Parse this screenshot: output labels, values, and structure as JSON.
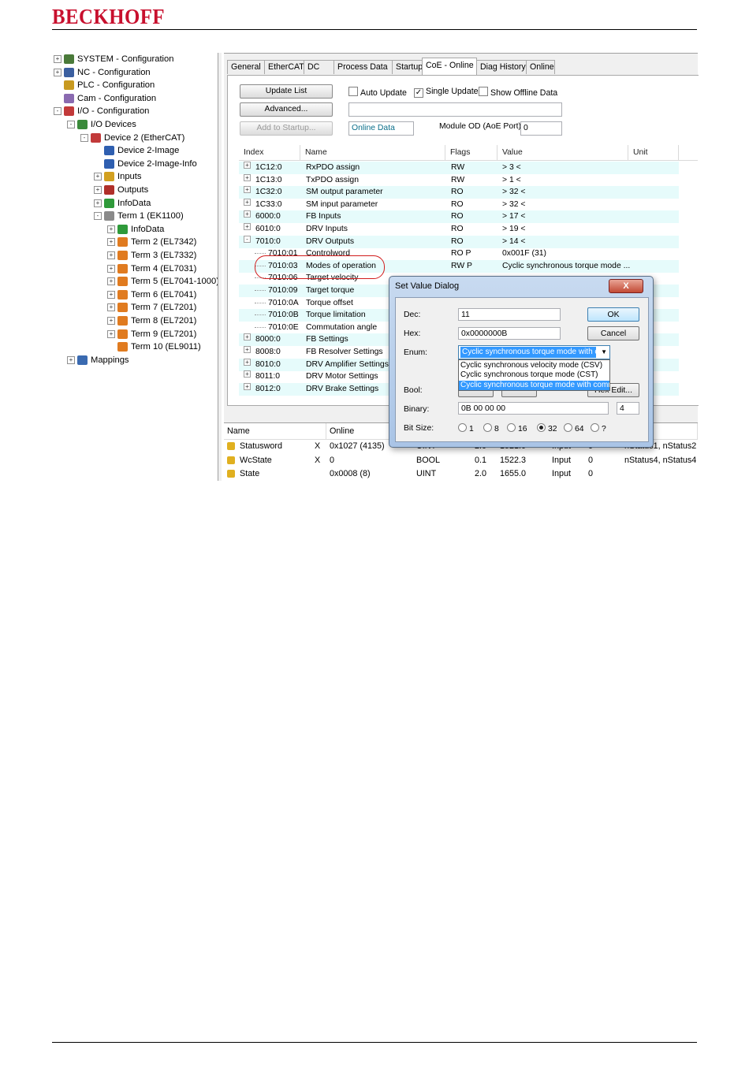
{
  "page": {
    "brand": "BECKHOFF",
    "brand_color": "#c8102e"
  },
  "tree": {
    "items": [
      {
        "label": "SYSTEM - Configuration",
        "icon": "system-config-icon"
      },
      {
        "label": "NC - Configuration",
        "icon": "nc-config-icon"
      },
      {
        "label": "PLC - Configuration",
        "icon": "plc-config-icon"
      },
      {
        "label": "Cam - Configuration",
        "icon": "cam-config-icon"
      },
      {
        "label": "I/O - Configuration",
        "icon": "io-config-icon"
      },
      {
        "label": "I/O Devices",
        "icon": "io-devices-icon"
      },
      {
        "label": "Device 2 (EtherCAT)",
        "icon": "ethercat-device-icon"
      },
      {
        "label": "Device 2-Image",
        "icon": "image-icon"
      },
      {
        "label": "Device 2-Image-Info",
        "icon": "image-info-icon"
      },
      {
        "label": "Inputs",
        "icon": "inputs-icon"
      },
      {
        "label": "Outputs",
        "icon": "outputs-icon"
      },
      {
        "label": "InfoData",
        "icon": "infodata-icon"
      },
      {
        "label": "Term 1 (EK1100)",
        "icon": "coupler-icon"
      },
      {
        "label": "InfoData",
        "icon": "infodata-icon"
      },
      {
        "label": "Term 2 (EL7342)",
        "icon": "terminal-icon"
      },
      {
        "label": "Term 3 (EL7332)",
        "icon": "terminal-icon"
      },
      {
        "label": "Term 4 (EL7031)",
        "icon": "terminal-icon"
      },
      {
        "label": "Term 5 (EL7041-1000)",
        "icon": "terminal-icon"
      },
      {
        "label": "Term 6 (EL7041)",
        "icon": "terminal-icon"
      },
      {
        "label": "Term 7 (EL7201)",
        "icon": "terminal-icon"
      },
      {
        "label": "Term 8 (EL7201)",
        "icon": "terminal-icon"
      },
      {
        "label": "Term 9 (EL7201)",
        "icon": "terminal-icon"
      },
      {
        "label": "Term 10 (EL9011)",
        "icon": "end-terminal-icon"
      },
      {
        "label": "Mappings",
        "icon": "mappings-icon"
      }
    ]
  },
  "tabs": [
    "General",
    "EtherCAT",
    "DC",
    "Process Data",
    "Startup",
    "CoE - Online",
    "Diag History",
    "Online"
  ],
  "coe": {
    "update_list": "Update List",
    "advanced": "Advanced...",
    "add_to_startup": "Add to Startup...",
    "auto_update": "Auto Update",
    "single_update": "Single Update",
    "show_offline": "Show Offline Data",
    "online_data": "Online Data",
    "module_od_label": "Module OD (AoE Port):",
    "module_od_value": "0",
    "headers": [
      "Index",
      "Name",
      "Flags",
      "Value",
      "Unit"
    ],
    "rows": [
      {
        "exp": "+",
        "index": "1C12:0",
        "name": "RxPDO assign",
        "flags": "RW",
        "value": "> 3 <"
      },
      {
        "exp": "+",
        "index": "1C13:0",
        "name": "TxPDO assign",
        "flags": "RW",
        "value": "> 1 <"
      },
      {
        "exp": "+",
        "index": "1C32:0",
        "name": "SM output parameter",
        "flags": "RO",
        "value": "> 32 <"
      },
      {
        "exp": "+",
        "index": "1C33:0",
        "name": "SM input parameter",
        "flags": "RO",
        "value": "> 32 <"
      },
      {
        "exp": "+",
        "index": "6000:0",
        "name": "FB Inputs",
        "flags": "RO",
        "value": "> 17 <"
      },
      {
        "exp": "+",
        "index": "6010:0",
        "name": "DRV Inputs",
        "flags": "RO",
        "value": "> 19 <"
      },
      {
        "exp": "-",
        "index": "7010:0",
        "name": "DRV Outputs",
        "flags": "RO",
        "value": "> 14 <"
      },
      {
        "exp": "",
        "index": "7010:01",
        "name": "Controlword",
        "flags": "RO P",
        "value": "0x001F (31)"
      },
      {
        "exp": "",
        "index": "7010:03",
        "name": "Modes of operation",
        "flags": "RW P",
        "value": "Cyclic synchronous torque mode ..."
      },
      {
        "exp": "",
        "index": "7010:06",
        "name": "Target velocity",
        "flags": "",
        "value": ""
      },
      {
        "exp": "",
        "index": "7010:09",
        "name": "Target torque",
        "flags": "",
        "value": ""
      },
      {
        "exp": "",
        "index": "7010:0A",
        "name": "Torque offset",
        "flags": "",
        "value": ""
      },
      {
        "exp": "",
        "index": "7010:0B",
        "name": "Torque limitation",
        "flags": "",
        "value": ""
      },
      {
        "exp": "",
        "index": "7010:0E",
        "name": "Commutation angle",
        "flags": "",
        "value": ""
      },
      {
        "exp": "+",
        "index": "8000:0",
        "name": "FB Settings",
        "flags": "",
        "value": ""
      },
      {
        "exp": "+",
        "index": "8008:0",
        "name": "FB Resolver Settings",
        "flags": "",
        "value": ""
      },
      {
        "exp": "+",
        "index": "8010:0",
        "name": "DRV Amplifier Settings",
        "flags": "",
        "value": ""
      },
      {
        "exp": "+",
        "index": "8011:0",
        "name": "DRV Motor Settings",
        "flags": "",
        "value": ""
      },
      {
        "exp": "+",
        "index": "8012:0",
        "name": "DRV Brake Settings",
        "flags": "",
        "value": ""
      }
    ]
  },
  "vars": {
    "headers": [
      "Name",
      "Online",
      "to"
    ],
    "rows": [
      {
        "name": "Statusword",
        "x": "X",
        "online": "0x1027 (4135)",
        "type": "UINT",
        "size": "2.0",
        "addr": "1521.0",
        "inout": "Input",
        "user": "0",
        "linked": "nStatus1, nStatus2"
      },
      {
        "name": "WcState",
        "x": "X",
        "online": "0",
        "type": "BOOL",
        "size": "0.1",
        "addr": "1522.3",
        "inout": "Input",
        "user": "0",
        "linked": "nStatus4, nStatus4"
      },
      {
        "name": "State",
        "x": "",
        "online": "0x0008 (8)",
        "type": "UINT",
        "size": "2.0",
        "addr": "1655.0",
        "inout": "Input",
        "user": "0",
        "linked": ""
      }
    ]
  },
  "dialog": {
    "title": "Set Value Dialog",
    "close": "X",
    "dec_label": "Dec:",
    "dec_value": "11",
    "hex_label": "Hex:",
    "hex_value": "0x0000000B",
    "enum_label": "Enum:",
    "enum_value": "Cyclic synchronous torque mode with c",
    "enum_options": [
      "Cyclic synchronous velocity mode (CSV)",
      "Cyclic synchronous torque mode (CST)",
      "Cyclic synchronous torque mode with comm"
    ],
    "bool_label": "Bool:",
    "hex_edit": "Hex Edit...",
    "binary_label": "Binary:",
    "binary_value": "0B 00 00 00",
    "binary_len": "4",
    "bitsize_label": "Bit Size:",
    "bitsizes": [
      "1",
      "8",
      "16",
      "32",
      "64",
      "?"
    ],
    "ok": "OK",
    "cancel": "Cancel"
  }
}
